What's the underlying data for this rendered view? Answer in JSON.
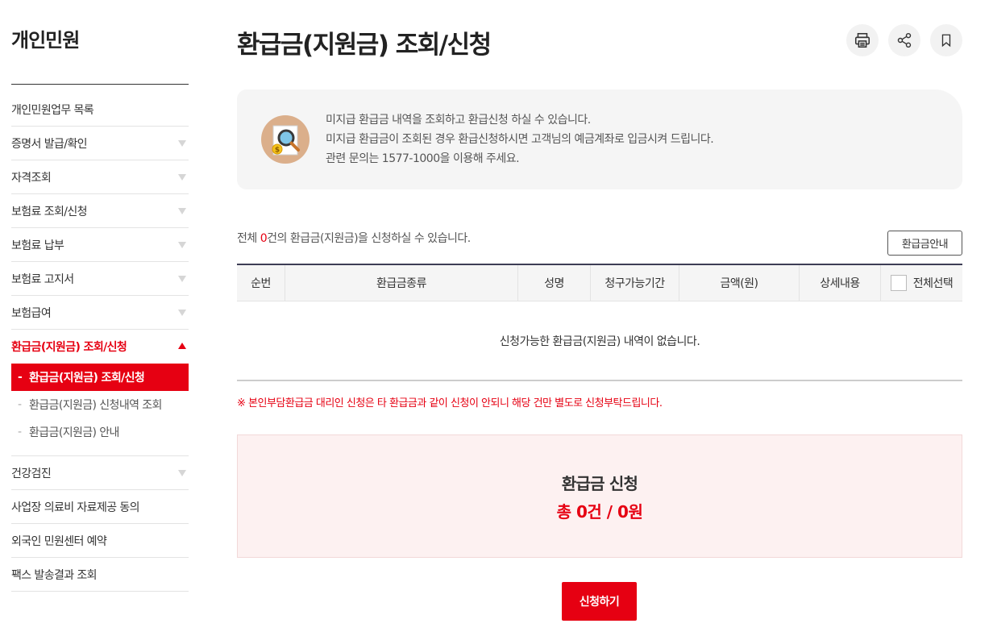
{
  "sidebar": {
    "title": "개인민원",
    "items": [
      {
        "label": "개인민원업무 목록",
        "has_chevron": false
      },
      {
        "label": "증명서 발급/확인",
        "has_chevron": true
      },
      {
        "label": "자격조회",
        "has_chevron": true
      },
      {
        "label": "보험료 조회/신청",
        "has_chevron": true
      },
      {
        "label": "보험료 납부",
        "has_chevron": true
      },
      {
        "label": "보험료 고지서",
        "has_chevron": true
      },
      {
        "label": "보험급여",
        "has_chevron": true
      },
      {
        "label": "환급금(지원금) 조회/신청",
        "has_chevron": true,
        "active": true
      }
    ],
    "sub_items": [
      {
        "dash": "-",
        "label": "환급금(지원금) 조회/신청",
        "current": true
      },
      {
        "dash": "-",
        "label": "환급금(지원금) 신청내역 조회"
      },
      {
        "dash": "-",
        "label": "환급금(지원금) 안내"
      }
    ],
    "items_after": [
      {
        "label": "건강검진",
        "has_chevron": true
      },
      {
        "label": "사업장 의료비 자료제공 동의",
        "has_chevron": false
      },
      {
        "label": "외국인 민원센터 예약",
        "has_chevron": false
      },
      {
        "label": "팩스 발송결과 조회",
        "has_chevron": false
      }
    ]
  },
  "header": {
    "title": "환급금(지원금) 조회/신청",
    "tools": [
      "printer-icon",
      "share-icon",
      "bookmark-icon"
    ]
  },
  "info": {
    "icon": "magnifier-document-icon",
    "lines": [
      "미지급 환급금 내역을 조회하고 환급신청 하실 수 있습니다.",
      "미지급 환급금이 조회된 경우 환급신청하시면 고객님의 예금계좌로 입금시켜 드립니다.",
      "관련 문의는 1577-1000을 이용해 주세요."
    ]
  },
  "summary": {
    "prefix": "전체 ",
    "count": "0",
    "suffix": "건의 환급금(지원금)을 신청하실 수 있습니다.",
    "guide_button": "환급금안내"
  },
  "table": {
    "headers": [
      "순번",
      "환급금종류",
      "성명",
      "청구가능기간",
      "금액(원)",
      "상세내용",
      "전체선택"
    ],
    "empty_message": "신청가능한 환급금(지원금) 내역이 없습니다."
  },
  "notice": "※ 본인부담환급금 대리인 신청은 타 환급금과 같이 신청이 안되니 해당 건만 별도로 신청부탁드립니다.",
  "apply": {
    "title": "환급금 신청",
    "total": "총 0건 / 0원",
    "button": "신청하기"
  },
  "colors": {
    "accent": "#e60012",
    "header_border": "#3d3d55",
    "info_bg": "#f5f5f5",
    "apply_bg": "#fdf1f1"
  }
}
